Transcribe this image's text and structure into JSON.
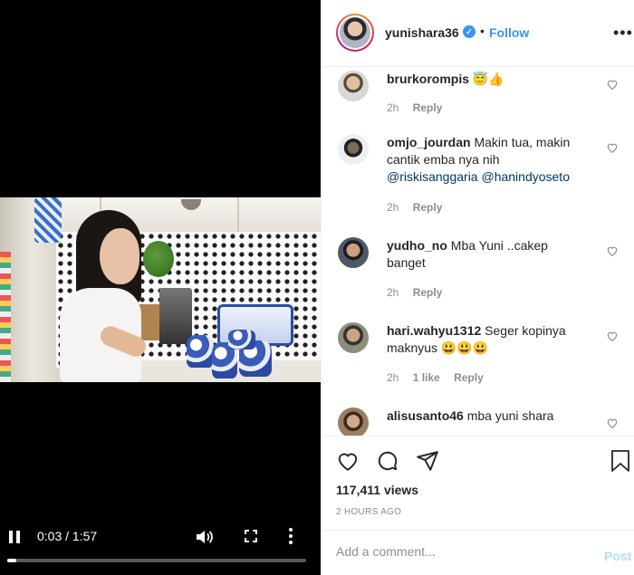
{
  "video": {
    "time": "0:03 / 1:57",
    "progress": 0.03,
    "icons": {
      "pause": "pause-icon",
      "volume": "volume-icon",
      "fullscreen": "fullscreen-icon",
      "more": "more-vertical-icon"
    }
  },
  "header": {
    "username": "yunishara36",
    "verified_icon": "verified-icon",
    "separator": "•",
    "follow_label": "Follow",
    "more_icon": "more-horizontal-icon"
  },
  "comments": [
    {
      "username": "brurkorompis",
      "text": "😇👍",
      "mentions": [],
      "time": "2h",
      "likes": "",
      "reply_label": "Reply"
    },
    {
      "username": "omjo_jourdan",
      "text": "Makin tua, makin cantik emba nya nih",
      "mentions": [
        "@riskisanggaria",
        "@hanindyoseto"
      ],
      "time": "2h",
      "likes": "",
      "reply_label": "Reply"
    },
    {
      "username": "yudho_no",
      "text": "Mba Yuni ..cakep banget",
      "mentions": [],
      "time": "2h",
      "likes": "",
      "reply_label": "Reply"
    },
    {
      "username": "hari.wahyu1312",
      "text": "Seger kopinya maknyus 😃😃😃",
      "mentions": [],
      "time": "2h",
      "likes": "1 like",
      "reply_label": "Reply"
    },
    {
      "username": "alisusanto46",
      "text": "mba yuni shara",
      "mentions": [],
      "time": "",
      "likes": "",
      "reply_label": ""
    }
  ],
  "actions": {
    "icons": [
      "heart-icon",
      "comment-icon",
      "share-icon",
      "bookmark-icon"
    ],
    "views": "117,411 views",
    "posted": "2 HOURS AGO"
  },
  "add_comment": {
    "placeholder": "Add a comment...",
    "post_label": "Post"
  },
  "colors": {
    "accent": "#3897f0",
    "post_disabled": "#b2dffc",
    "meta_text": "#8e8e8e",
    "mention": "#00376b"
  }
}
